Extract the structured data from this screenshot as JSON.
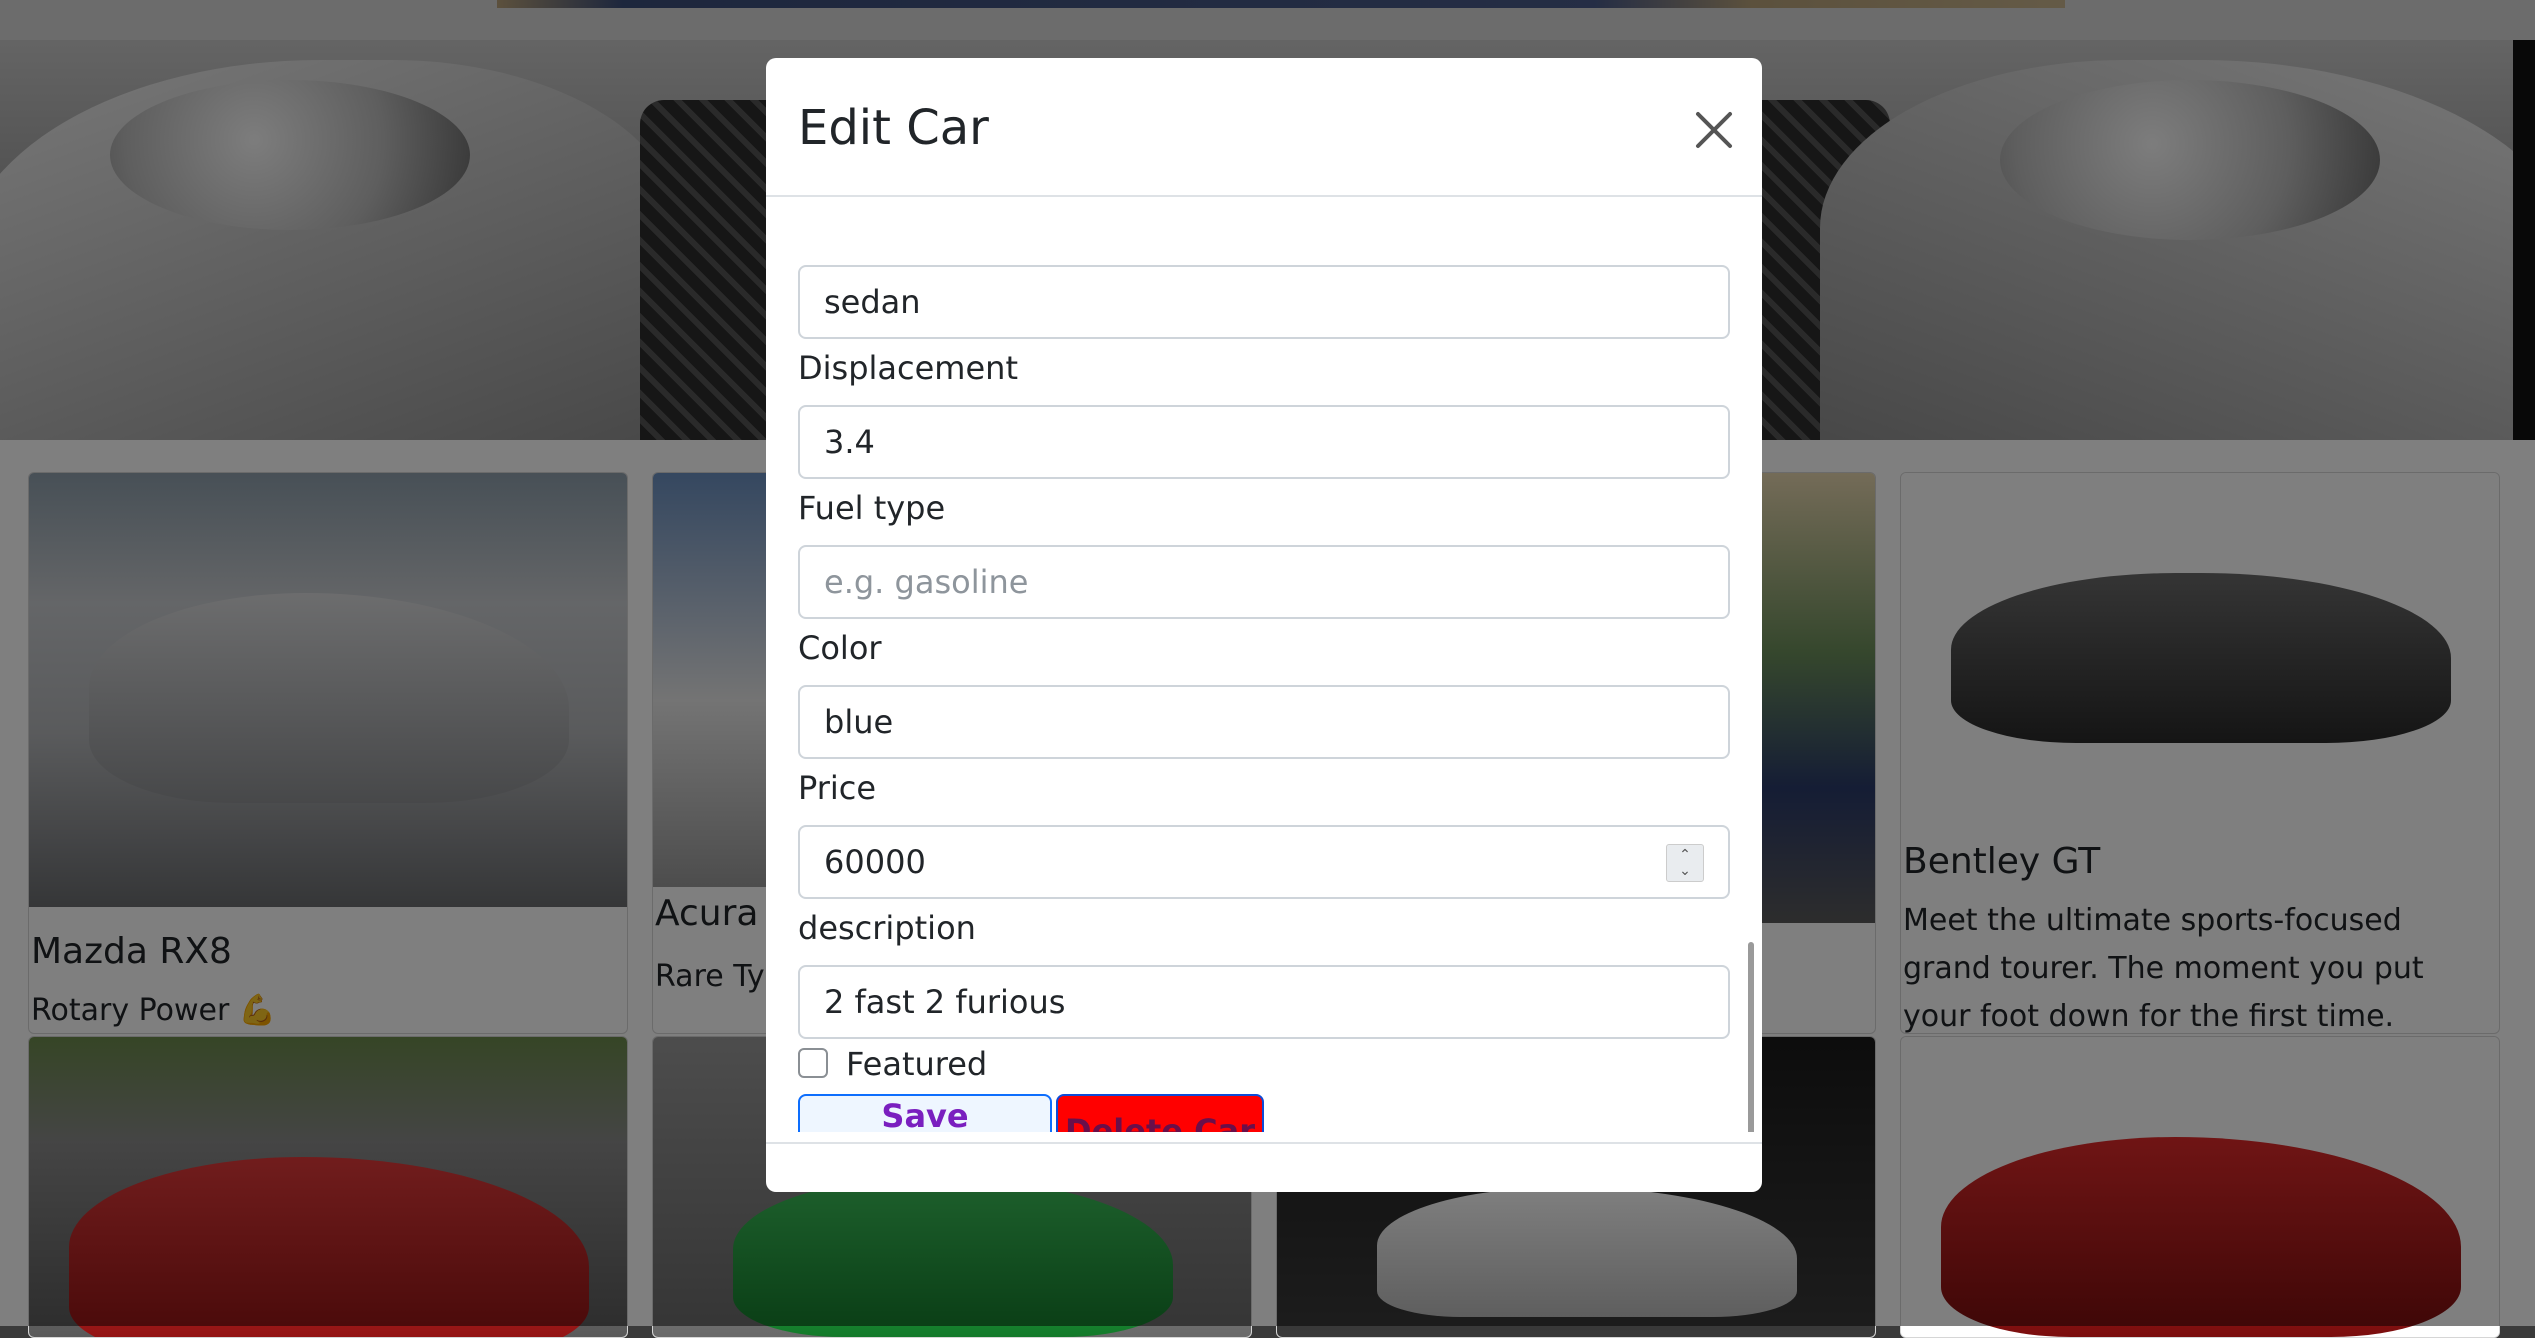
{
  "modal": {
    "title": "Edit Car",
    "close_label": "×",
    "fields": {
      "type": {
        "value": "sedan"
      },
      "displacement": {
        "label": "Displacement",
        "value": "3.4"
      },
      "fuel_type": {
        "label": "Fuel type",
        "value": "",
        "placeholder": "e.g. gasoline"
      },
      "color": {
        "label": "Color",
        "value": "blue"
      },
      "price": {
        "label": "Price",
        "value": "60000"
      },
      "description": {
        "label": "description",
        "value": "2 fast 2 furious"
      }
    },
    "featured": {
      "label": "Featured",
      "checked": false
    },
    "buttons": {
      "save": "Save Changes",
      "delete": "Delete Car"
    }
  },
  "cards": [
    {
      "title": "Mazda RX8",
      "text": "Rotary Power 💪"
    },
    {
      "title": "Acura",
      "text": "Rare Typ"
    },
    {
      "title": "",
      "text": ""
    },
    {
      "title": "Bentley GT",
      "text": "Meet the ultimate sports-focused grand tourer. The moment you put your foot down for the first time."
    }
  ],
  "colors": {
    "save_text": "#7a1fbf",
    "delete_bg": "#ff0000",
    "delete_text": "#6a0f4a",
    "overlay": "rgba(0,0,0,0.5)"
  }
}
